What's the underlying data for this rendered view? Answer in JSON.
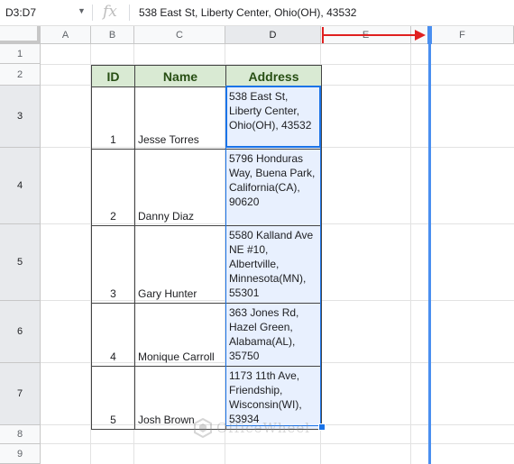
{
  "formula_bar": {
    "name_box": "D3:D7",
    "fx_label": "fx",
    "formula": "538 East St, Liberty Center, Ohio(OH), 43532"
  },
  "columns": [
    "A",
    "B",
    "C",
    "D",
    "E",
    "F"
  ],
  "rows": [
    "1",
    "2",
    "3",
    "4",
    "5",
    "6",
    "7",
    "8",
    "9"
  ],
  "table": {
    "headers": [
      "ID",
      "Name",
      "Address"
    ],
    "rows": [
      {
        "id": "1",
        "name": "Jesse Torres",
        "address": "538 East St, Liberty Center, Ohio(OH), 43532"
      },
      {
        "id": "2",
        "name": "Danny Diaz",
        "address": "5796 Honduras Way, Buena Park, California(CA), 90620"
      },
      {
        "id": "3",
        "name": "Gary Hunter",
        "address": "5580 Kalland Ave NE #10, Albertville, Minnesota(MN), 55301"
      },
      {
        "id": "4",
        "name": "Monique Carroll",
        "address": "363 Jones Rd, Hazel Green, Alabama(AL), 35750"
      },
      {
        "id": "5",
        "name": "Josh Brown",
        "address": "1173 11th Ave, Friendship, Wisconsin(WI), 53934"
      }
    ]
  },
  "watermark": "OfficeWheel",
  "colors": {
    "header_fill": "#d9ead3",
    "header_text": "#274e13",
    "selection": "#1a73e8",
    "arrow": "#e02020"
  }
}
